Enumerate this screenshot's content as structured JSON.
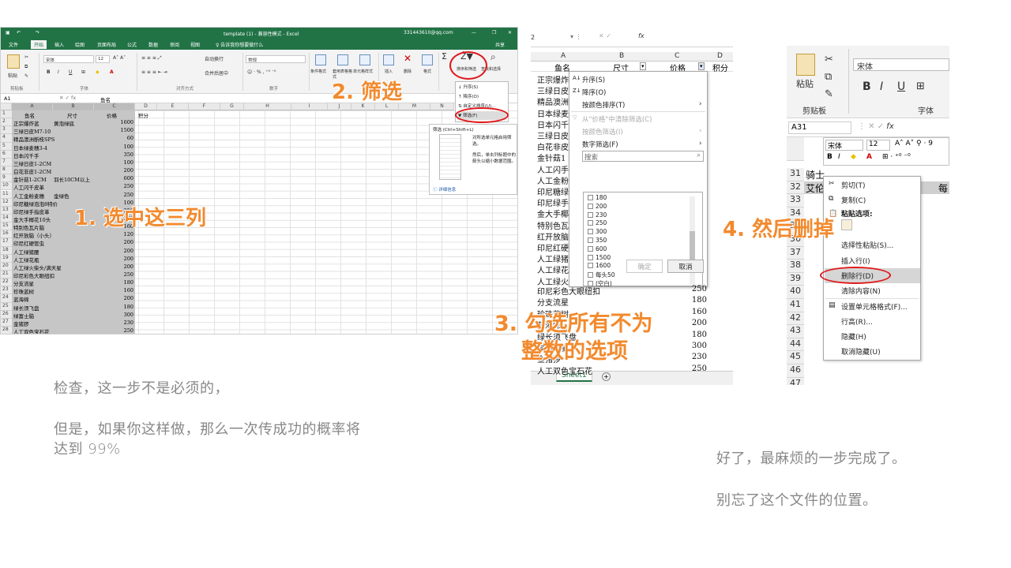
{
  "shot1": {
    "title_center": "template (1)  -  兼容性模式  -  Excel",
    "account": "331443610@qq.com",
    "tabs": [
      "文件",
      "开始",
      "插入",
      "绘图",
      "页面布局",
      "公式",
      "数据",
      "审阅",
      "视图"
    ],
    "tell_me": "♀ 告诉我你想要做什么",
    "share": "共享",
    "font_name": "宋体",
    "font_size": "12",
    "number_format": "常规",
    "wrap_text": "自动换行",
    "merge_center": "合并后居中",
    "group_clipboard": "剪贴板",
    "group_font": "字体",
    "group_align": "对齐方式",
    "group_number": "数字",
    "paste_label": "粘贴",
    "cond_format": "条件格式",
    "table_format": "套用表格格式",
    "cell_style": "单元格样式",
    "insert": "插入",
    "delete": "删除",
    "format": "格式",
    "sort_filter": "排序和筛选",
    "find_select": "查找和选择",
    "name_box": "A1",
    "formula_value": "鱼名",
    "columns": [
      "A",
      "B",
      "C",
      "D",
      "E",
      "F",
      "G",
      "H",
      "I",
      "J",
      "K",
      "L",
      "M",
      "N"
    ],
    "header_row": {
      "a": "鱼名",
      "b": "尺寸",
      "c": "价格",
      "d": "积分"
    },
    "rows": [
      {
        "a": "正宗爆炸蓝",
        "b": "黄泡绿底",
        "c": "1600"
      },
      {
        "a": "三绿日皮M7-10",
        "b": "",
        "c": "1500"
      },
      {
        "a": "精品澳洲断枝SPS",
        "b": "",
        "c": "60"
      },
      {
        "a": "日本绿麦穗3-4",
        "b": "",
        "c": "100"
      },
      {
        "a": "日本闪千手",
        "b": "",
        "c": "350"
      },
      {
        "a": "三绿日皮1-2CM",
        "b": "",
        "c": "100"
      },
      {
        "a": "白花非皮1-2CM",
        "b": "",
        "c": "200"
      },
      {
        "a": "金针菇1-2CM",
        "b": "羽长10CM以上",
        "c": "600"
      },
      {
        "a": "人工闪千皮革",
        "b": "",
        "c": "250"
      },
      {
        "a": "人工金粉麦穗",
        "b": "金绿色",
        "c": "250"
      },
      {
        "a": "印尼糖绿泡泡8特价",
        "b": "",
        "c": "100"
      },
      {
        "a": "印尼绿手指皮革",
        "b": "",
        "c": "250"
      },
      {
        "a": "金大手椰花10头",
        "b": "",
        "c": "200"
      },
      {
        "a": "特别色瓦片脑",
        "b": "",
        "c": "160"
      },
      {
        "a": "红开放脑（小头）",
        "b": "",
        "c": "120"
      },
      {
        "a": "印尼红硬管虫",
        "b": "",
        "c": "200"
      },
      {
        "a": "人工绿猪腰",
        "b": "",
        "c": "200"
      },
      {
        "a": "人工绿花瓶",
        "b": "",
        "c": "200"
      },
      {
        "a": "人工绿火柴头/满天星",
        "b": "",
        "c": "200"
      },
      {
        "a": "印尼彩色大眼纽扣",
        "b": "",
        "c": "250"
      },
      {
        "a": "分支流星",
        "b": "",
        "c": "180"
      },
      {
        "a": "珍珠蓝树",
        "b": "",
        "c": "160"
      },
      {
        "a": "蓝海绵",
        "b": "",
        "c": "200"
      },
      {
        "a": "绿长须飞盘",
        "b": "",
        "c": "180"
      },
      {
        "a": "绿富士脑",
        "b": "",
        "c": "300"
      },
      {
        "a": "金猪猡",
        "b": "",
        "c": "230"
      },
      {
        "a": "人工双色宝石花",
        "b": "",
        "c": "250"
      }
    ],
    "dd_items": [
      "升序(S)",
      "降序(O)",
      "自定义排序(U)...",
      "筛选(F)"
    ],
    "tip_title": "筛选 (Ctrl+Shift+L)",
    "tip_text1": "对所选单元格启用筛选。",
    "tip_text2": "然后，单击列标题中的箭头以缩小数据范围。",
    "tip_more": "详细信息"
  },
  "steps": {
    "s1": "1. 选中这三列",
    "s2": "2. 筛选",
    "s3a": "3. 勾选所有不为",
    "s3b": "整数的选项",
    "s4": "4. 然后删掉"
  },
  "shot2": {
    "name_box": "2",
    "fx": "fx",
    "cols": [
      "A",
      "B",
      "C",
      "D"
    ],
    "hdr": {
      "a": "鱼名",
      "b": "尺寸",
      "c": "价格",
      "d": "积分"
    },
    "left_names": [
      "正宗爆炸",
      "三绿日皮",
      "精品澳洲",
      "日本绿麦",
      "日本闪千",
      "三绿日皮",
      "白花非皮",
      "金针菇1",
      "人工闪手",
      "人工金粉",
      "印尼糖绿",
      "印尼绿手",
      "金大手椰",
      "特别色瓦",
      "红开放脑",
      "印尼红硬",
      "人工绿猪",
      "人工绿花",
      "人工绿火"
    ],
    "bottom_rows": [
      {
        "a": "印尼彩色大眼纽扣",
        "c": "250"
      },
      {
        "a": "分支流星",
        "c": "180"
      },
      {
        "a": "珍珠蓝树",
        "c": "160"
      },
      {
        "a": "蓝海绵",
        "c": "200"
      },
      {
        "a": "绿长须飞盘",
        "c": "180"
      },
      {
        "a": "绿富士脑",
        "c": "300"
      },
      {
        "a": "金猪猡",
        "c": "230"
      },
      {
        "a": "人工双色宝石花",
        "c": "250"
      }
    ],
    "menu": {
      "asc": "升序(S)",
      "desc": "降序(O)",
      "by_color": "按颜色排序(T)",
      "clear": "从\"价格\"中清除筛选(C)",
      "color_filter": "按颜色筛选(I)",
      "num_filter": "数字筛选(F)",
      "search_ph": "搜索",
      "ok": "确定",
      "cancel": "取消"
    },
    "values": [
      "180",
      "200",
      "230",
      "250",
      "300",
      "350",
      "600",
      "1500",
      "1600",
      "每头50",
      "(空白)"
    ],
    "sheet_tab": "Sheet1"
  },
  "shot3": {
    "paste": "粘贴",
    "font": "宋体",
    "group_clipboard": "剪贴板",
    "group_font": "字体",
    "name_box": "A31",
    "mini_font": "宋体",
    "mini_size": "12",
    "rows": [
      "31",
      "32",
      "33",
      "34",
      "35",
      "36",
      "37",
      "38",
      "39",
      "40",
      "41",
      "42",
      "43",
      "44",
      "45",
      "46",
      "47"
    ],
    "r31": "骑士",
    "r32": "艾伦",
    "r32_right": "每",
    "menu": [
      "剪切(T)",
      "复制(C)",
      "粘贴选项:",
      "选择性粘贴(S)...",
      "插入行(I)",
      "删除行(D)",
      "清除内容(N)",
      "设置单元格格式(F)...",
      "行高(R)...",
      "隐藏(H)",
      "取消隐藏(U)"
    ]
  },
  "notes": {
    "left1": "检查，这一步不是必须的，",
    "left2": "但是，如果你这样做，那么一次传成功的概率将",
    "left3": "达到 99%",
    "right1": "好了，最麻烦的一步完成了。",
    "right2": "别忘了这个文件的位置。"
  },
  "colors": {
    "excel_green": "#217346",
    "step_orange": "#f28a2e",
    "ring_red": "#e0181b"
  }
}
